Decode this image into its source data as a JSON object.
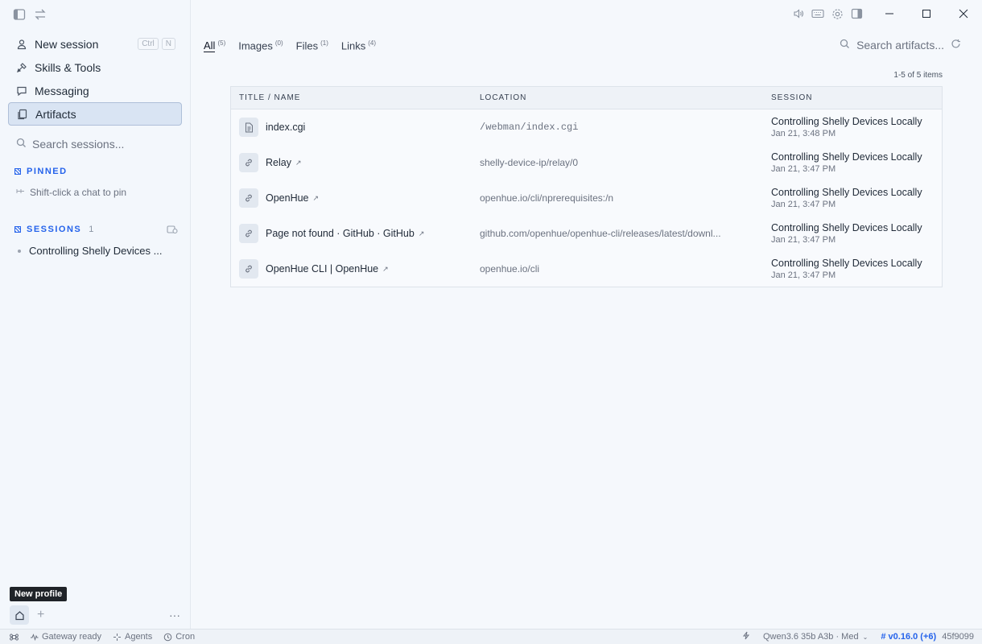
{
  "sidebar": {
    "nav": [
      {
        "label": "New session",
        "icon": "new-session-icon",
        "kbd": [
          "Ctrl",
          "N"
        ]
      },
      {
        "label": "Skills & Tools",
        "icon": "skills-icon"
      },
      {
        "label": "Messaging",
        "icon": "messaging-icon"
      },
      {
        "label": "Artifacts",
        "icon": "artifacts-icon",
        "active": true
      }
    ],
    "search_placeholder": "Search sessions...",
    "pinned_header": "PINNED",
    "pin_hint": "Shift-click a chat to pin",
    "sessions_header": "SESSIONS",
    "sessions_count": "1",
    "sessions": [
      {
        "title": "Controlling Shelly Devices ..."
      }
    ],
    "tooltip": "New profile"
  },
  "main": {
    "tabs": [
      {
        "label": "All",
        "count": "(5)"
      },
      {
        "label": "Images",
        "count": "(0)"
      },
      {
        "label": "Files",
        "count": "(1)"
      },
      {
        "label": "Links",
        "count": "(4)"
      }
    ],
    "search_placeholder": "Search artifacts...",
    "count_text": "1-5 of 5 items",
    "columns": [
      "TITLE / NAME",
      "LOCATION",
      "SESSION"
    ],
    "rows": [
      {
        "title": "index.cgi",
        "type": "file",
        "location": "/webman/index.cgi",
        "session": "Controlling Shelly Devices Locally",
        "date": "Jan 21, 3:48 PM"
      },
      {
        "title": "Relay",
        "type": "link",
        "location": "shelly-device-ip/relay/0",
        "session": "Controlling Shelly Devices Locally",
        "date": "Jan 21, 3:47 PM"
      },
      {
        "title": "OpenHue",
        "type": "link",
        "location": "openhue.io/cli/nprerequisites:/n",
        "session": "Controlling Shelly Devices Locally",
        "date": "Jan 21, 3:47 PM"
      },
      {
        "title": "Page not found · GitHub · GitHub",
        "type": "link",
        "location": "github.com/openhue/openhue-cli/releases/latest/downl...",
        "session": "Controlling Shelly Devices Locally",
        "date": "Jan 21, 3:47 PM"
      },
      {
        "title": "OpenHue CLI | OpenHue",
        "type": "link",
        "location": "openhue.io/cli",
        "session": "Controlling Shelly Devices Locally",
        "date": "Jan 21, 3:47 PM"
      }
    ]
  },
  "statusbar": {
    "gateway": "Gateway ready",
    "agents": "Agents",
    "cron": "Cron",
    "model": "Qwen3.6 35b A3b · Med",
    "version": "v0.16.0 (+6)",
    "hash": "45f9099"
  },
  "colors": {
    "accent": "#2563eb",
    "active_nav_bg": "#d9e4f3"
  }
}
